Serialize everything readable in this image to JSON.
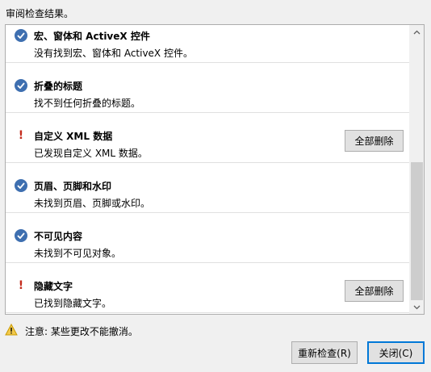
{
  "header": {
    "text": "审阅检查结果。"
  },
  "items": [
    {
      "status": "ok",
      "title": "宏、窗体和 ActiveX 控件",
      "desc": "没有找到宏、窗体和 ActiveX 控件。",
      "button": ""
    },
    {
      "status": "ok",
      "title": "折叠的标题",
      "desc": "找不到任何折叠的标题。",
      "button": ""
    },
    {
      "status": "warn",
      "title": "自定义 XML 数据",
      "desc": "已发现自定义 XML 数据。",
      "button": "全部删除"
    },
    {
      "status": "ok",
      "title": "页眉、页脚和水印",
      "desc": "未找到页眉、页脚或水印。",
      "button": ""
    },
    {
      "status": "ok",
      "title": "不可见内容",
      "desc": "未找到不可见对象。",
      "button": ""
    },
    {
      "status": "warn",
      "title": "隐藏文字",
      "desc": "已找到隐藏文字。",
      "button": "全部删除"
    }
  ],
  "notice": {
    "text": "注意: 某些更改不能撤消。",
    "icon": "warning-icon"
  },
  "buttons": {
    "recheck": "重新检查(R)",
    "close": "关闭(C)"
  },
  "colors": {
    "check": "#3e6fb0",
    "warn": "#c42b1c",
    "focus": "#0078d7"
  }
}
